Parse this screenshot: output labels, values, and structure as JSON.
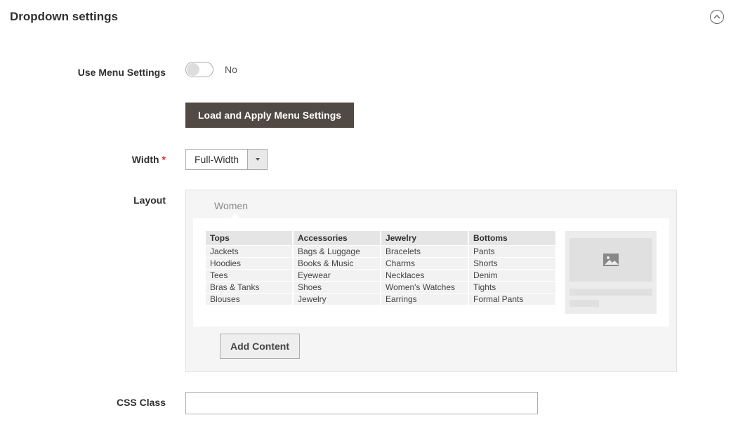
{
  "panel": {
    "title": "Dropdown settings"
  },
  "useMenuSettings": {
    "label": "Use Menu Settings",
    "value": "No"
  },
  "loadApply": {
    "label": "Load and Apply Menu Settings"
  },
  "width": {
    "label": "Width",
    "selected": "Full-Width"
  },
  "layout": {
    "label": "Layout",
    "tab": "Women",
    "columns": [
      {
        "header": "Tops",
        "items": [
          "Jackets",
          "Hoodies",
          "Tees",
          "Bras & Tanks",
          "Blouses"
        ]
      },
      {
        "header": "Accessories",
        "items": [
          "Bags & Luggage",
          "Books & Music",
          "Eyewear",
          "Shoes",
          "Jewelry"
        ]
      },
      {
        "header": "Jewelry",
        "items": [
          "Bracelets",
          "Charms",
          "Necklaces",
          "Women's Watches",
          "Earrings"
        ]
      },
      {
        "header": "Bottoms",
        "items": [
          "Pants",
          "Shorts",
          "Denim",
          "Tights",
          "Formal Pants"
        ]
      }
    ],
    "addContent": "Add Content"
  },
  "cssClass": {
    "label": "CSS Class",
    "value": ""
  }
}
